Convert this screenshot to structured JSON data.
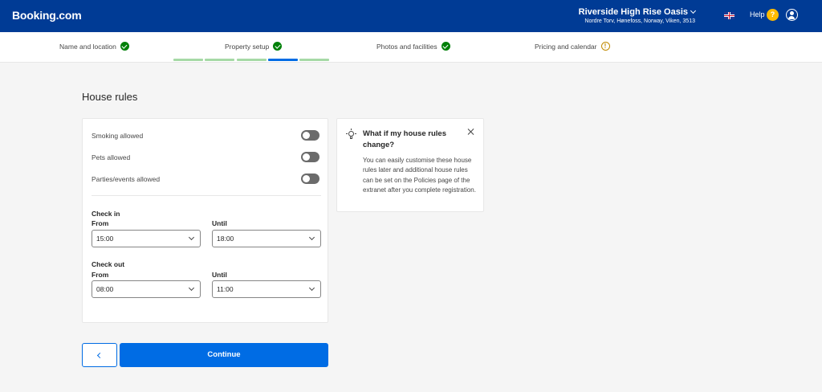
{
  "header": {
    "logo": "Booking.com",
    "property_name": "Riverside High Rise Oasis",
    "property_address": "Nordre Torv, Hønefoss, Norway, Viken, 3513",
    "help_label": "Help",
    "help_badge": "?"
  },
  "steps": [
    {
      "label": "Name and location",
      "status": "complete"
    },
    {
      "label": "Property setup",
      "status": "complete"
    },
    {
      "label": "Photos and facilities",
      "status": "complete"
    },
    {
      "label": "Pricing and calendar",
      "status": "warning"
    },
    {
      "label": "",
      "status": "upcoming"
    }
  ],
  "step_progress": {
    "segments": 5,
    "active_segment": 4
  },
  "page": {
    "heading": "House rules"
  },
  "house_rules": {
    "rules": [
      {
        "label": "Smoking allowed",
        "enabled": false
      },
      {
        "label": "Pets allowed",
        "enabled": false
      },
      {
        "label": "Parties/events allowed",
        "enabled": false
      }
    ],
    "check_in": {
      "title": "Check in",
      "from_label": "From",
      "from_value": "15:00",
      "until_label": "Until",
      "until_value": "18:00"
    },
    "check_out": {
      "title": "Check out",
      "from_label": "From",
      "from_value": "08:00",
      "until_label": "Until",
      "until_value": "11:00"
    }
  },
  "tip": {
    "title": "What if my house rules change?",
    "body": "You can easily customise these house rules later and additional house rules can be set on the Policies page of the extranet after you complete registration."
  },
  "actions": {
    "back_label": "",
    "continue_label": "Continue"
  },
  "colors": {
    "brand": "#003b95",
    "accent": "#006ce4",
    "success": "#008009",
    "warning": "#c08a00"
  }
}
